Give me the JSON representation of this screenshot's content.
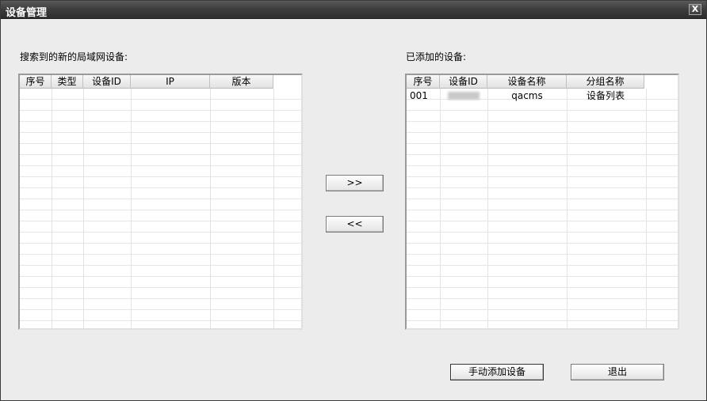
{
  "window": {
    "title": "设备管理",
    "close_label": "X"
  },
  "left": {
    "label": "搜索到的新的局域网设备:",
    "columns": [
      "序号",
      "类型",
      "设备ID",
      "IP",
      "版本"
    ]
  },
  "right": {
    "label": "已添加的设备:",
    "columns": [
      "序号",
      "设备ID",
      "设备名称",
      "分组名称"
    ],
    "rows": [
      {
        "index": "001",
        "device_id": "",
        "device_name": "qacms",
        "group_name": "设备列表"
      }
    ]
  },
  "buttons": {
    "add_selected": ">>",
    "remove_selected": "<<",
    "manual_add": "手动添加设备",
    "exit": "退出"
  }
}
